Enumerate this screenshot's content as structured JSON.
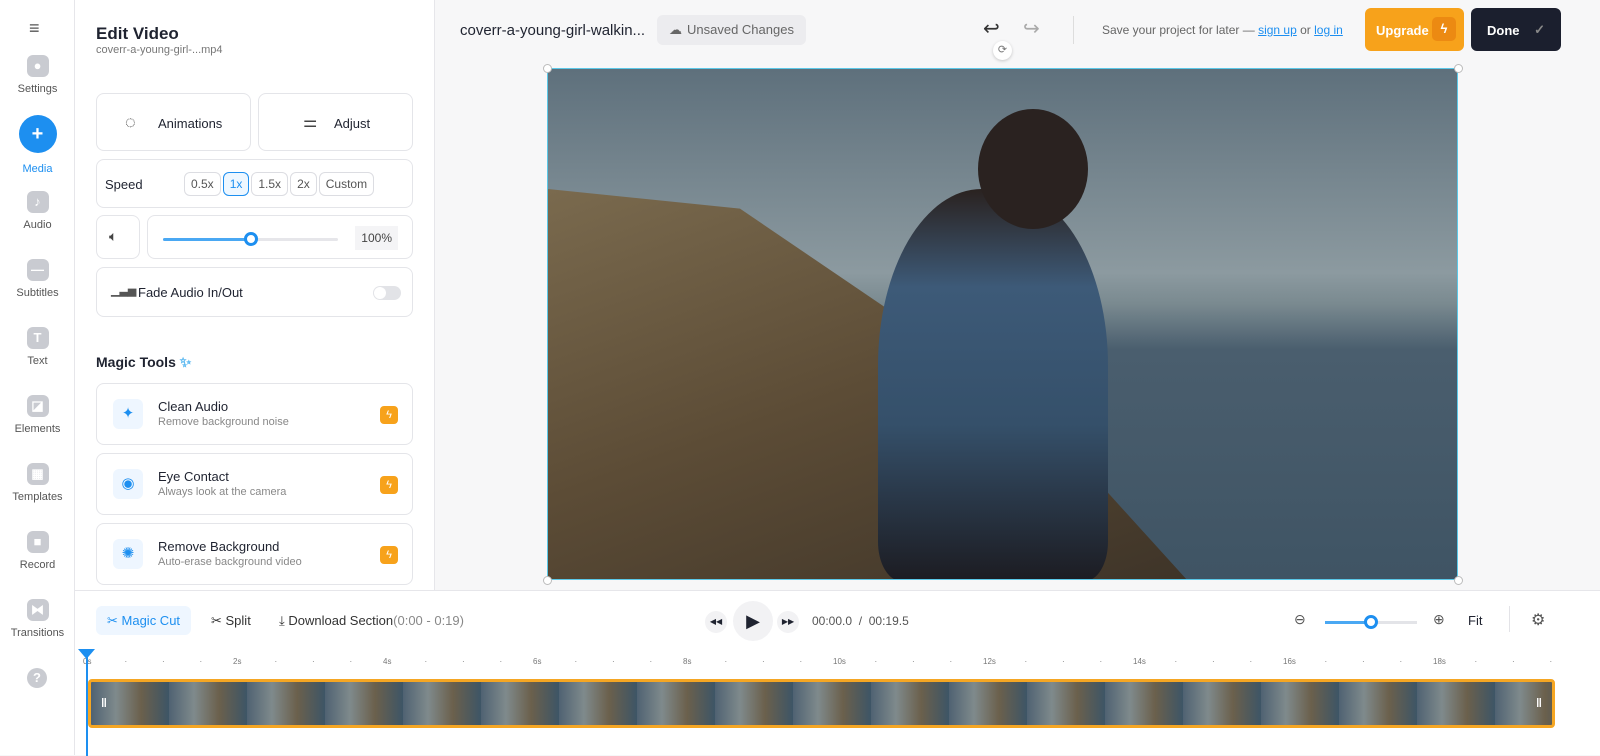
{
  "rail": {
    "items": [
      {
        "label": "Settings",
        "icon": "gear-icon",
        "glyph": "●"
      },
      {
        "label": "Media",
        "icon": "plus-icon",
        "glyph": "+",
        "active": true
      },
      {
        "label": "Audio",
        "icon": "music-note-icon",
        "glyph": "♪"
      },
      {
        "label": "Subtitles",
        "icon": "subtitles-icon",
        "glyph": "—"
      },
      {
        "label": "Text",
        "icon": "text-icon",
        "glyph": "T"
      },
      {
        "label": "Elements",
        "icon": "elements-icon",
        "glyph": "◪"
      },
      {
        "label": "Templates",
        "icon": "templates-icon",
        "glyph": "▦"
      },
      {
        "label": "Record",
        "icon": "record-icon",
        "glyph": "■"
      },
      {
        "label": "Transitions",
        "icon": "transitions-icon",
        "glyph": "⧓"
      }
    ]
  },
  "panel": {
    "title": "Edit Video",
    "filename": "coverr-a-young-girl-...mp4",
    "animations": "Animations",
    "adjust": "Adjust",
    "speed": {
      "label": "Speed",
      "options": [
        "0.5x",
        "1x",
        "1.5x",
        "2x",
        "Custom"
      ],
      "selected": "1x"
    },
    "volume": {
      "value": "100%",
      "level": 0.5
    },
    "fade": {
      "label": "Fade Audio In/Out",
      "on": false
    },
    "magic_title": "Magic Tools",
    "tools": [
      {
        "title": "Clean Audio",
        "sub": "Remove background noise",
        "icon": "sparkle-icon",
        "glyph": "✦"
      },
      {
        "title": "Eye Contact",
        "sub": "Always look at the camera",
        "icon": "eye-icon",
        "glyph": "◉"
      },
      {
        "title": "Remove Background",
        "sub": "Auto-erase background video",
        "icon": "remove-bg-icon",
        "glyph": "✺"
      }
    ]
  },
  "top": {
    "project": "coverr-a-young-girl-walkin...",
    "unsaved": "Unsaved Changes",
    "save_text": "Save your project for later —",
    "sign_up": "sign up",
    "or": "or",
    "log_in": "log in",
    "upgrade": "Upgrade",
    "done": "Done"
  },
  "bottom": {
    "magic_cut": "Magic Cut",
    "split": "Split",
    "download": "Download Section",
    "range": "(0:00 - 0:19)",
    "current": "00:00.0",
    "sep": "/",
    "total": "00:19.5",
    "fit": "Fit",
    "zoom_level": 0.5,
    "ticks": [
      "0s",
      "2s",
      "4s",
      "6s",
      "8s",
      "10s",
      "12s",
      "14s",
      "16s",
      "18s"
    ]
  },
  "colors": {
    "accent": "#1d8ff0",
    "upgrade": "#f7a21b",
    "done": "#1b1f2e",
    "clip_border": "#f5a623"
  }
}
